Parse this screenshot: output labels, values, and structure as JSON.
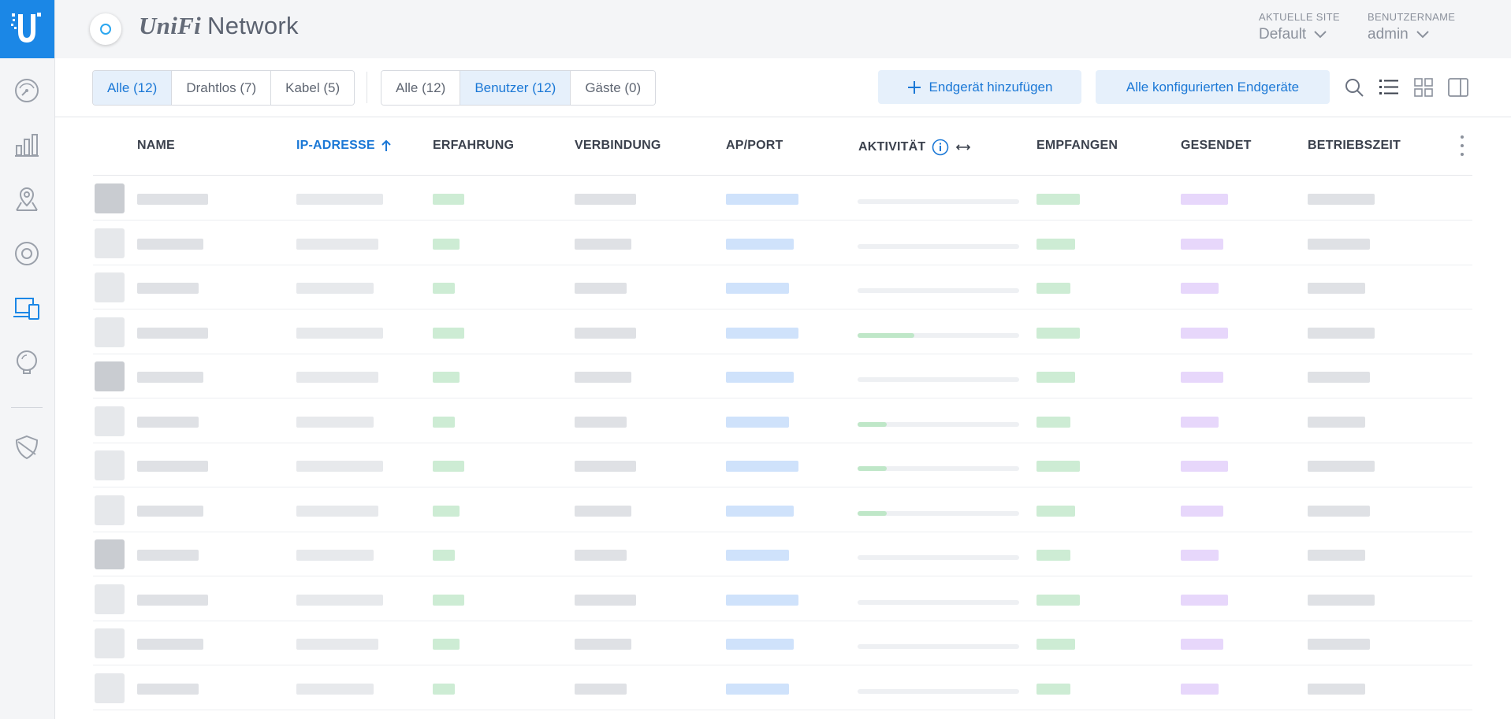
{
  "header": {
    "brand_a": "UniFi",
    "brand_b": "Network",
    "site_label": "AKTUELLE SITE",
    "site_value": "Default",
    "user_label": "BENUTZERNAME",
    "user_value": "admin"
  },
  "nav": {
    "items": [
      "dashboard-icon",
      "statistics-icon",
      "map-icon",
      "devices-icon",
      "clients-icon",
      "insights-icon",
      "threat-management-icon"
    ],
    "active": "clients-icon"
  },
  "toolbar": {
    "filter_conn": [
      {
        "label": "Alle (12)",
        "active": true
      },
      {
        "label": "Drahtlos (7)",
        "active": false
      },
      {
        "label": "Kabel (5)",
        "active": false
      }
    ],
    "filter_type": [
      {
        "label": "Alle (12)",
        "active": false
      },
      {
        "label": "Benutzer (12)",
        "active": true
      },
      {
        "label": "Gäste (0)",
        "active": false
      }
    ],
    "add_label": "Endgerät hinzufügen",
    "all_configured_label": "Alle konfigurierten Endgeräte"
  },
  "table": {
    "columns": [
      "NAME",
      "IP-ADRESSE",
      "ERFAHRUNG",
      "VERBINDUNG",
      "AP/PORT",
      "AKTIVITÄT",
      "EMPFANGEN",
      "GESENDET",
      "BETRIEBSZEIT"
    ],
    "sorted_column": "IP-ADRESSE",
    "sort_direction": "ascending",
    "row_count": 12,
    "activity_levels": [
      0,
      0,
      0,
      0.35,
      0,
      0.18,
      0.18,
      0.18,
      0,
      0,
      0,
      0
    ]
  },
  "colors": {
    "accent": "#1b87e6",
    "accent_text": "#1b78d6",
    "active_bg": "#e6f0fb",
    "header_bg": "#f4f5f7"
  }
}
